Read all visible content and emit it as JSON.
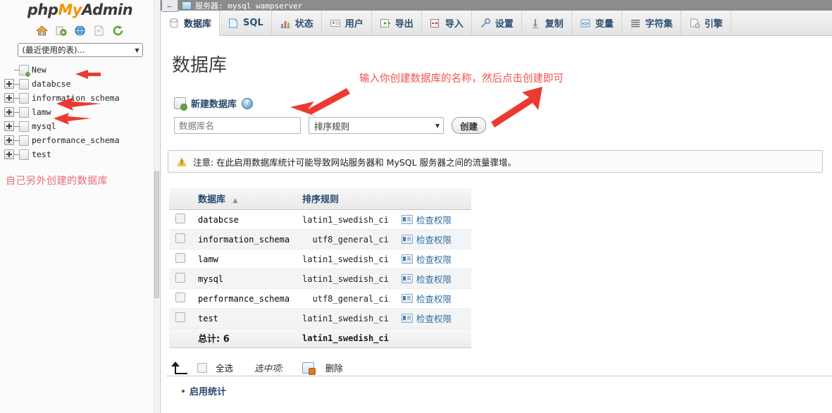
{
  "branding": {
    "logo_part1": "php",
    "logo_part2": "My",
    "logo_part3": "Admin"
  },
  "sidebar": {
    "icons": [
      {
        "name": "home-icon",
        "label": "Home"
      },
      {
        "name": "logout-icon",
        "label": "Log out"
      },
      {
        "name": "documentation-globe-icon",
        "label": "phpMyAdmin documentation"
      },
      {
        "name": "docs-page-icon",
        "label": "Documentation"
      },
      {
        "name": "reload-icon",
        "label": "Reload navigation"
      }
    ],
    "recent_select_value": "(最近使用的表)...",
    "recent_select_caret": "▼",
    "tree": [
      {
        "label": "New",
        "expandable": false,
        "new": true
      },
      {
        "label": "databcse",
        "expandable": true,
        "new": false
      },
      {
        "label": "information_schema",
        "expandable": true,
        "new": false
      },
      {
        "label": "lamw",
        "expandable": true,
        "new": false
      },
      {
        "label": "mysql",
        "expandable": true,
        "new": false
      },
      {
        "label": "performance_schema",
        "expandable": true,
        "new": false
      },
      {
        "label": "test",
        "expandable": true,
        "new": false
      }
    ],
    "note": "自己另外创建的数据库"
  },
  "server_bar": {
    "back_arrow": "←",
    "title": "服务器: mysql wampserver"
  },
  "tabs": [
    {
      "label": "数据库",
      "icon": "database-icon",
      "active": true
    },
    {
      "label": "SQL",
      "icon": "sql-page-icon",
      "active": false
    },
    {
      "label": "状态",
      "icon": "status-chart-icon",
      "active": false
    },
    {
      "label": "用户",
      "icon": "users-icon",
      "active": false
    },
    {
      "label": "导出",
      "icon": "export-icon",
      "active": false
    },
    {
      "label": "导入",
      "icon": "import-icon",
      "active": false
    },
    {
      "label": "设置",
      "icon": "settings-wrench-icon",
      "active": false
    },
    {
      "label": "复制",
      "icon": "replication-icon",
      "active": false
    },
    {
      "label": "变量",
      "icon": "variables-icon",
      "active": false
    },
    {
      "label": "字符集",
      "icon": "charset-icon",
      "active": false
    },
    {
      "label": "引擎",
      "icon": "engines-icon",
      "active": false
    }
  ],
  "main": {
    "page_title": "数据库",
    "new_db": {
      "heading": "新建数据库",
      "help_glyph": "?",
      "name_placeholder": "数据库名",
      "collation_value": "排序规则",
      "collation_caret": "▼",
      "create_button": "创建"
    },
    "notice": "注意: 在此启用数据库统计可能导致网站服务器和 MySQL 服务器之间的流量骤增。",
    "table": {
      "headers": [
        "数据库",
        "排序规则",
        ""
      ],
      "sort_indicator": "▲",
      "rows": [
        {
          "name": "databcse",
          "collation": "latin1_swedish_ci",
          "action": "检查权限"
        },
        {
          "name": "information_schema",
          "collation": "utf8_general_ci",
          "action": "检查权限"
        },
        {
          "name": "lamw",
          "collation": "latin1_swedish_ci",
          "action": "检查权限"
        },
        {
          "name": "mysql",
          "collation": "latin1_swedish_ci",
          "action": "检查权限"
        },
        {
          "name": "performance_schema",
          "collation": "utf8_general_ci",
          "action": "检查权限"
        },
        {
          "name": "test",
          "collation": "latin1_swedish_ci",
          "action": "检查权限"
        }
      ],
      "total_label": "总计: 6",
      "total_collation": "latin1_swedish_ci"
    },
    "footer": {
      "select_all": "全选",
      "with_selected": "选中项:",
      "drop": "删除",
      "enable_stats": "启用统计"
    }
  },
  "annotations": {
    "top_note": "输入你创建数据库的名称，然后点击创建即可",
    "arrow_color": "#ec3a32",
    "note_color": "#ef5350"
  }
}
